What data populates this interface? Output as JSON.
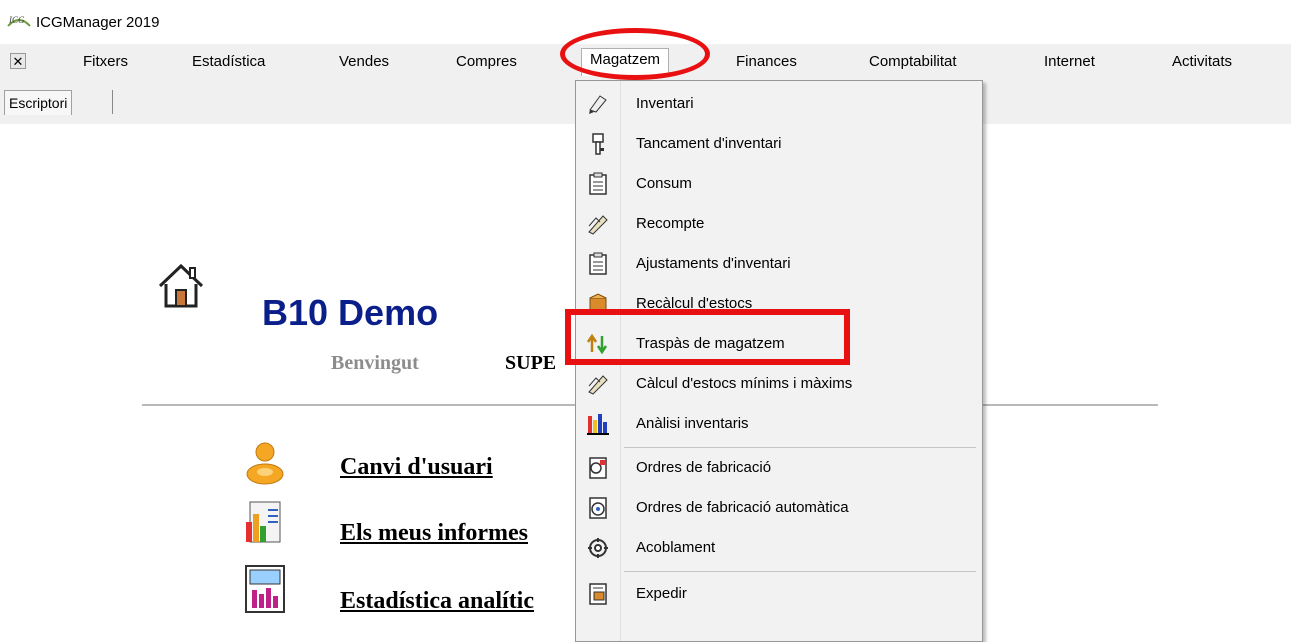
{
  "window": {
    "title": "ICGManager 2019",
    "logo_text": "ICG"
  },
  "menubar": {
    "close_label": "✕",
    "items": [
      {
        "label": "Fitxers"
      },
      {
        "label": "Estadística"
      },
      {
        "label": "Vendes"
      },
      {
        "label": "Compres"
      },
      {
        "label": "Magatzem"
      },
      {
        "label": "Finances"
      },
      {
        "label": "Comptabilitat"
      },
      {
        "label": "Internet"
      },
      {
        "label": "Activitats"
      }
    ],
    "active": "Magatzem"
  },
  "tabs": [
    {
      "label": "Escriptori"
    }
  ],
  "desktop": {
    "company": "B10 Demo",
    "welcome": "Benvingut",
    "user": "SUPE",
    "links": [
      {
        "label": "Canvi d'usuari",
        "icon": "user-icon"
      },
      {
        "label": "Els meus informes",
        "icon": "reports-icon"
      },
      {
        "label": "Estadística analític",
        "icon": "analytics-icon"
      }
    ]
  },
  "dropdown": {
    "items": [
      {
        "label": "Inventari",
        "icon": "inventory-icon"
      },
      {
        "label": "Tancament d'inventari",
        "icon": "key-icon"
      },
      {
        "label": "Consum",
        "icon": "clipboard-icon"
      },
      {
        "label": "Recompte",
        "icon": "pencil-icon"
      },
      {
        "label": "Ajustaments d'inventari",
        "icon": "clipboard-icon"
      },
      {
        "label": "Recàlcul d'estocs",
        "icon": "box-icon"
      },
      {
        "label": "Traspàs de magatzem",
        "icon": "transfer-arrows-icon"
      },
      {
        "label": "Càlcul d'estocs mínims i màxims",
        "icon": "pencil-icon"
      },
      {
        "label": "Anàlisi inventaris",
        "icon": "bar-chart-icon"
      },
      {
        "label": "Ordres de fabricació",
        "icon": "factory-order-icon"
      },
      {
        "label": "Ordres de fabricació automàtica",
        "icon": "auto-order-icon"
      },
      {
        "label": "Acoblament",
        "icon": "assembly-icon"
      },
      {
        "label": "Expedir",
        "icon": "ship-icon"
      }
    ],
    "highlighted": "Traspàs de magatzem"
  },
  "colors": {
    "annotation": "#e81010",
    "company": "#0b1f8a",
    "welcome": "#8c8c8c"
  }
}
